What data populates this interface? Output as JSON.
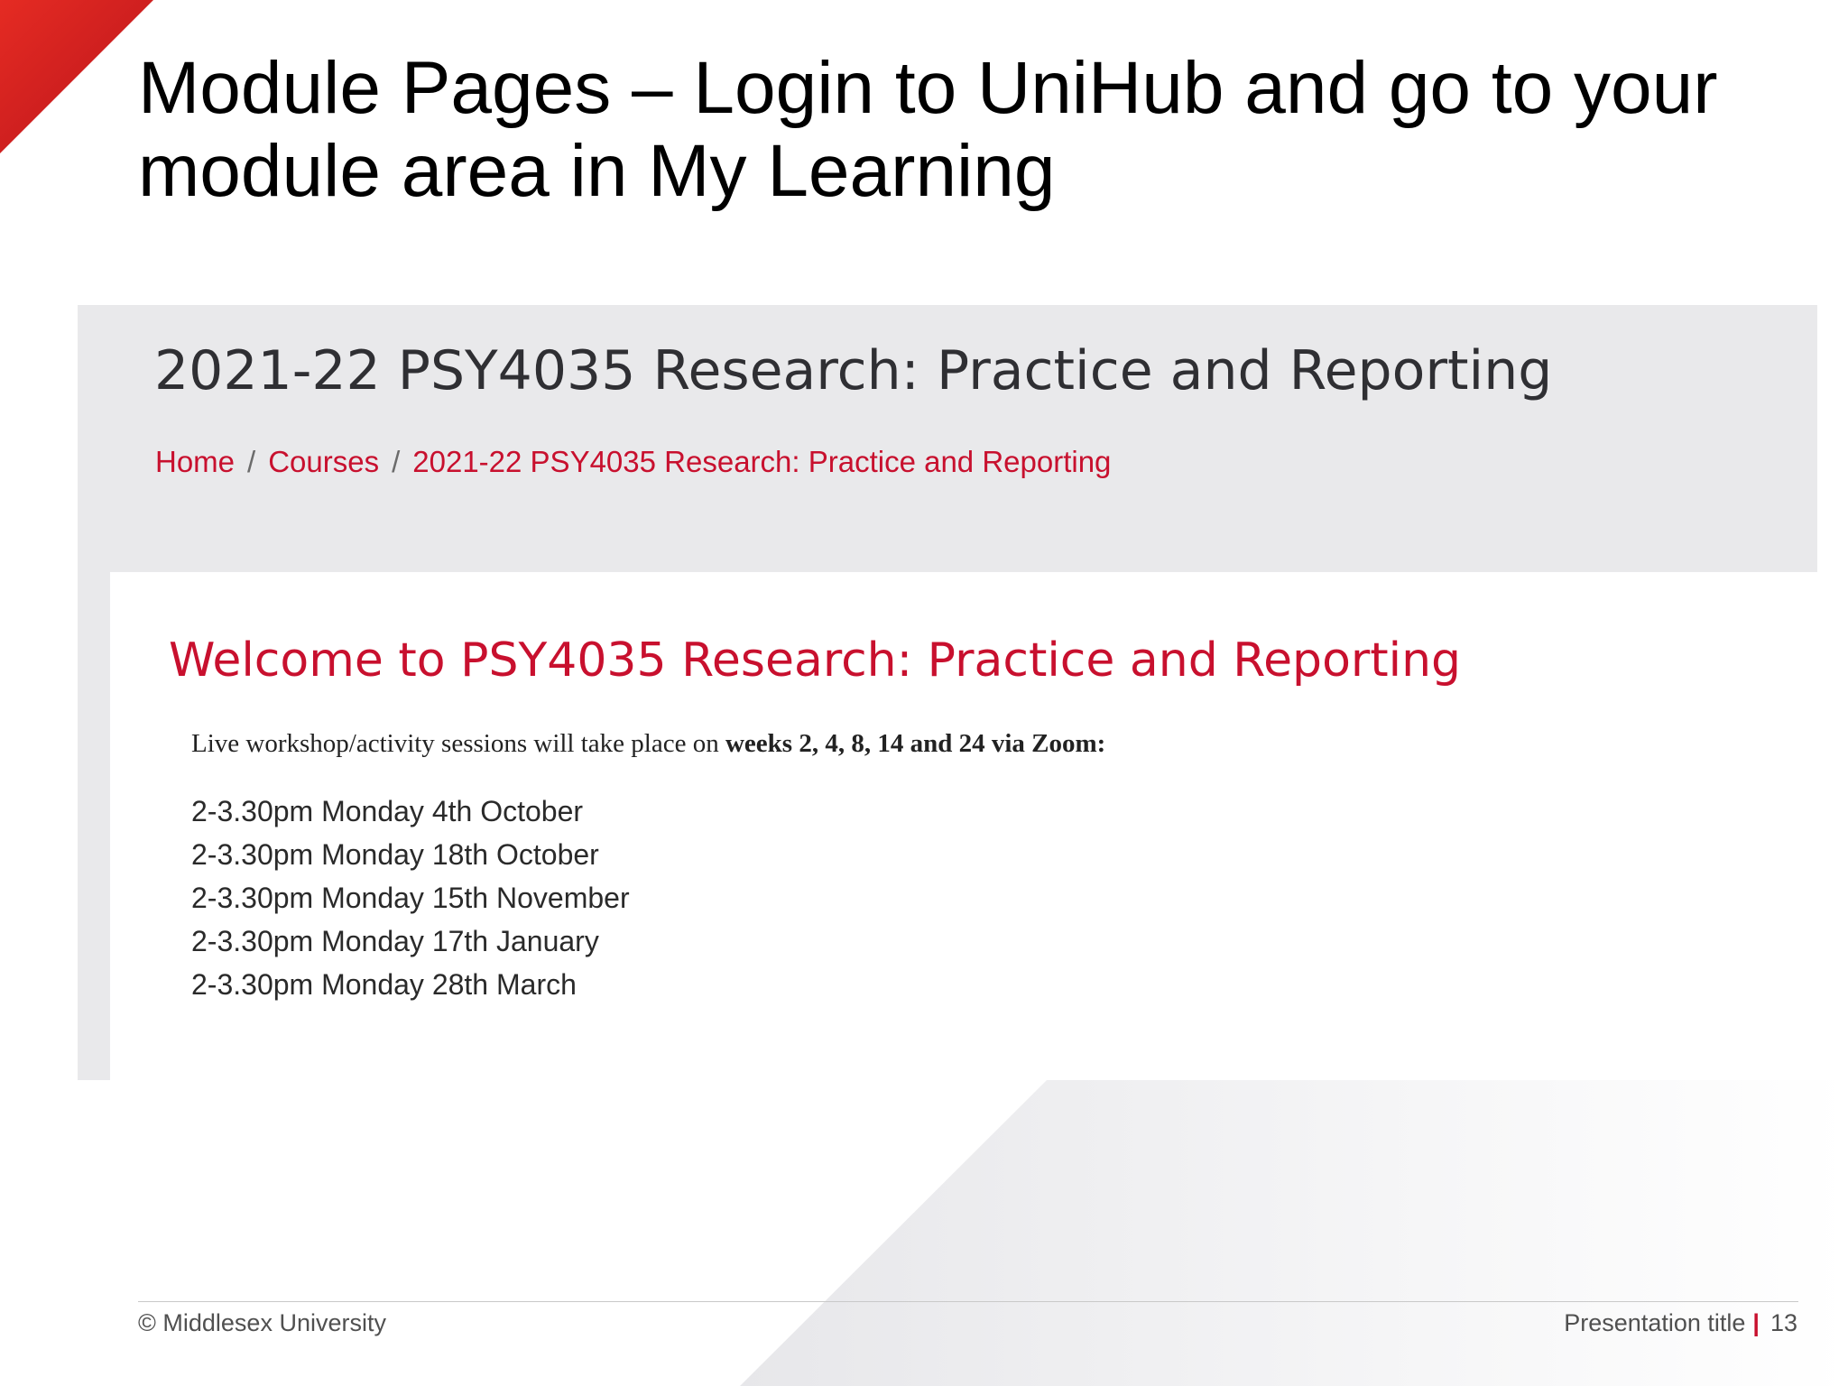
{
  "slide": {
    "title_line1": "Module Pages – Login to UniHub and go to your",
    "title_line2": "module area in My Learning",
    "accent_color": "#d8231f"
  },
  "course_page": {
    "course_title": "2021-22 PSY4035 Research: Practice and Reporting",
    "breadcrumb": [
      "Home",
      "Courses",
      "2021-22 PSY4035 Research: Practice and Reporting"
    ],
    "breadcrumb_separator": "/",
    "welcome_heading": "Welcome to PSY4035 Research: Practice and Reporting",
    "intro_plain": "Live workshop/activity sessions will take place on ",
    "intro_bold": "weeks 2, 4, 8, 14 and 24 via Zoom:",
    "sessions": [
      "2-3.30pm Monday 4th October",
      "2-3.30pm Monday 18th October",
      "2-3.30pm Monday 15th November",
      "2-3.30pm Monday 17th January",
      "2-3.30pm Monday 28th March"
    ],
    "link_color": "#c8102e"
  },
  "footer": {
    "copyright": "© Middlesex University",
    "presentation_title": "Presentation title",
    "divider": "|",
    "page_number": "13"
  }
}
